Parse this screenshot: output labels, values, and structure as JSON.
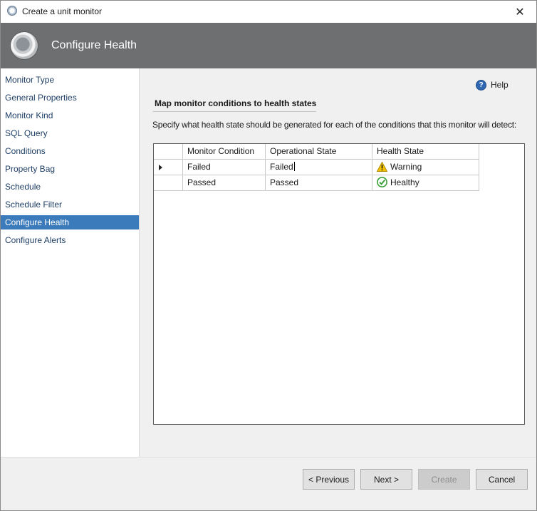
{
  "window": {
    "title": "Create a unit monitor",
    "close_glyph": "✕"
  },
  "header": {
    "title": "Configure Health",
    "icon": "monitor-wizard-icon"
  },
  "nav": {
    "items": [
      {
        "label": "Monitor Type"
      },
      {
        "label": "General Properties"
      },
      {
        "label": "Monitor Kind"
      },
      {
        "label": "SQL Query"
      },
      {
        "label": "Conditions"
      },
      {
        "label": "Property Bag"
      },
      {
        "label": "Schedule"
      },
      {
        "label": "Schedule Filter"
      },
      {
        "label": "Configure Health",
        "active": true
      },
      {
        "label": "Configure Alerts"
      }
    ]
  },
  "help": {
    "label": "Help",
    "icon_glyph": "?"
  },
  "content": {
    "section_title": "Map monitor conditions to health states",
    "description": "Specify what health state should be generated for each of the conditions that this monitor will detect:"
  },
  "grid": {
    "columns": [
      "Monitor Condition",
      "Operational State",
      "Health State"
    ],
    "rows": [
      {
        "condition": "Failed",
        "operational_state": "Failed",
        "health_state": "Warning",
        "health_icon": "warning-icon",
        "selected": true
      },
      {
        "condition": "Passed",
        "operational_state": "Passed",
        "health_state": "Healthy",
        "health_icon": "healthy-check-icon",
        "selected": false
      }
    ]
  },
  "buttons": {
    "previous": "< Previous",
    "next": "Next >",
    "create": "Create",
    "cancel": "Cancel"
  },
  "colors": {
    "header_bg": "#6d6f71",
    "nav_active_bg": "#3c7bbb",
    "nav_text": "#1f3f66",
    "warning": "#f2c200",
    "healthy": "#3aa13a"
  }
}
